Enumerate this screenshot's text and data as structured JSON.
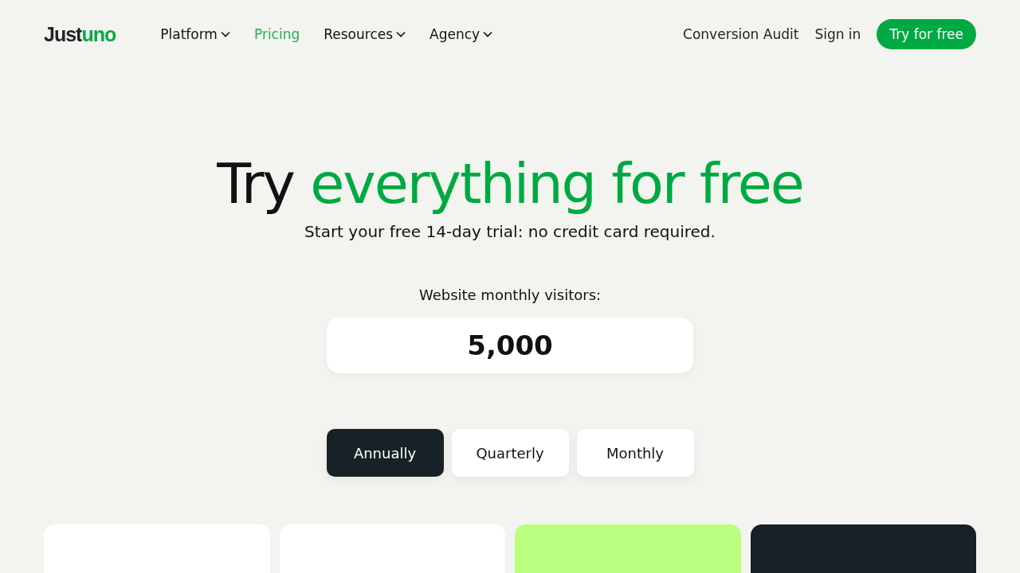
{
  "logo": {
    "part_1": "Just",
    "part_2": "uno"
  },
  "nav": [
    {
      "label": "Platform",
      "selected": false,
      "dropdown": true
    },
    {
      "label": "Pricing",
      "selected": true,
      "dropdown": false
    },
    {
      "label": "Resources",
      "selected": false,
      "dropdown": true
    },
    {
      "label": "Agency",
      "selected": false,
      "dropdown": true
    }
  ],
  "header_links": [
    "Conversion Audit",
    "Sign in"
  ],
  "cta": "Try for free",
  "hero": {
    "title_plain": "Try",
    "title_accent": "everything for free",
    "subtitle": "Start your free 14-day trial: no credit card required."
  },
  "visitors": {
    "label": "Website monthly visitors:",
    "value": "5,000"
  },
  "billing": [
    {
      "label": "Annually",
      "selected": true
    },
    {
      "label": "Quarterly",
      "selected": false
    },
    {
      "label": "Monthly",
      "selected": false
    }
  ],
  "plan_cards": [
    {
      "color": "#ffffff"
    },
    {
      "color": "#ffffff"
    },
    {
      "color": "#baff7d"
    },
    {
      "color": "#172126"
    }
  ]
}
